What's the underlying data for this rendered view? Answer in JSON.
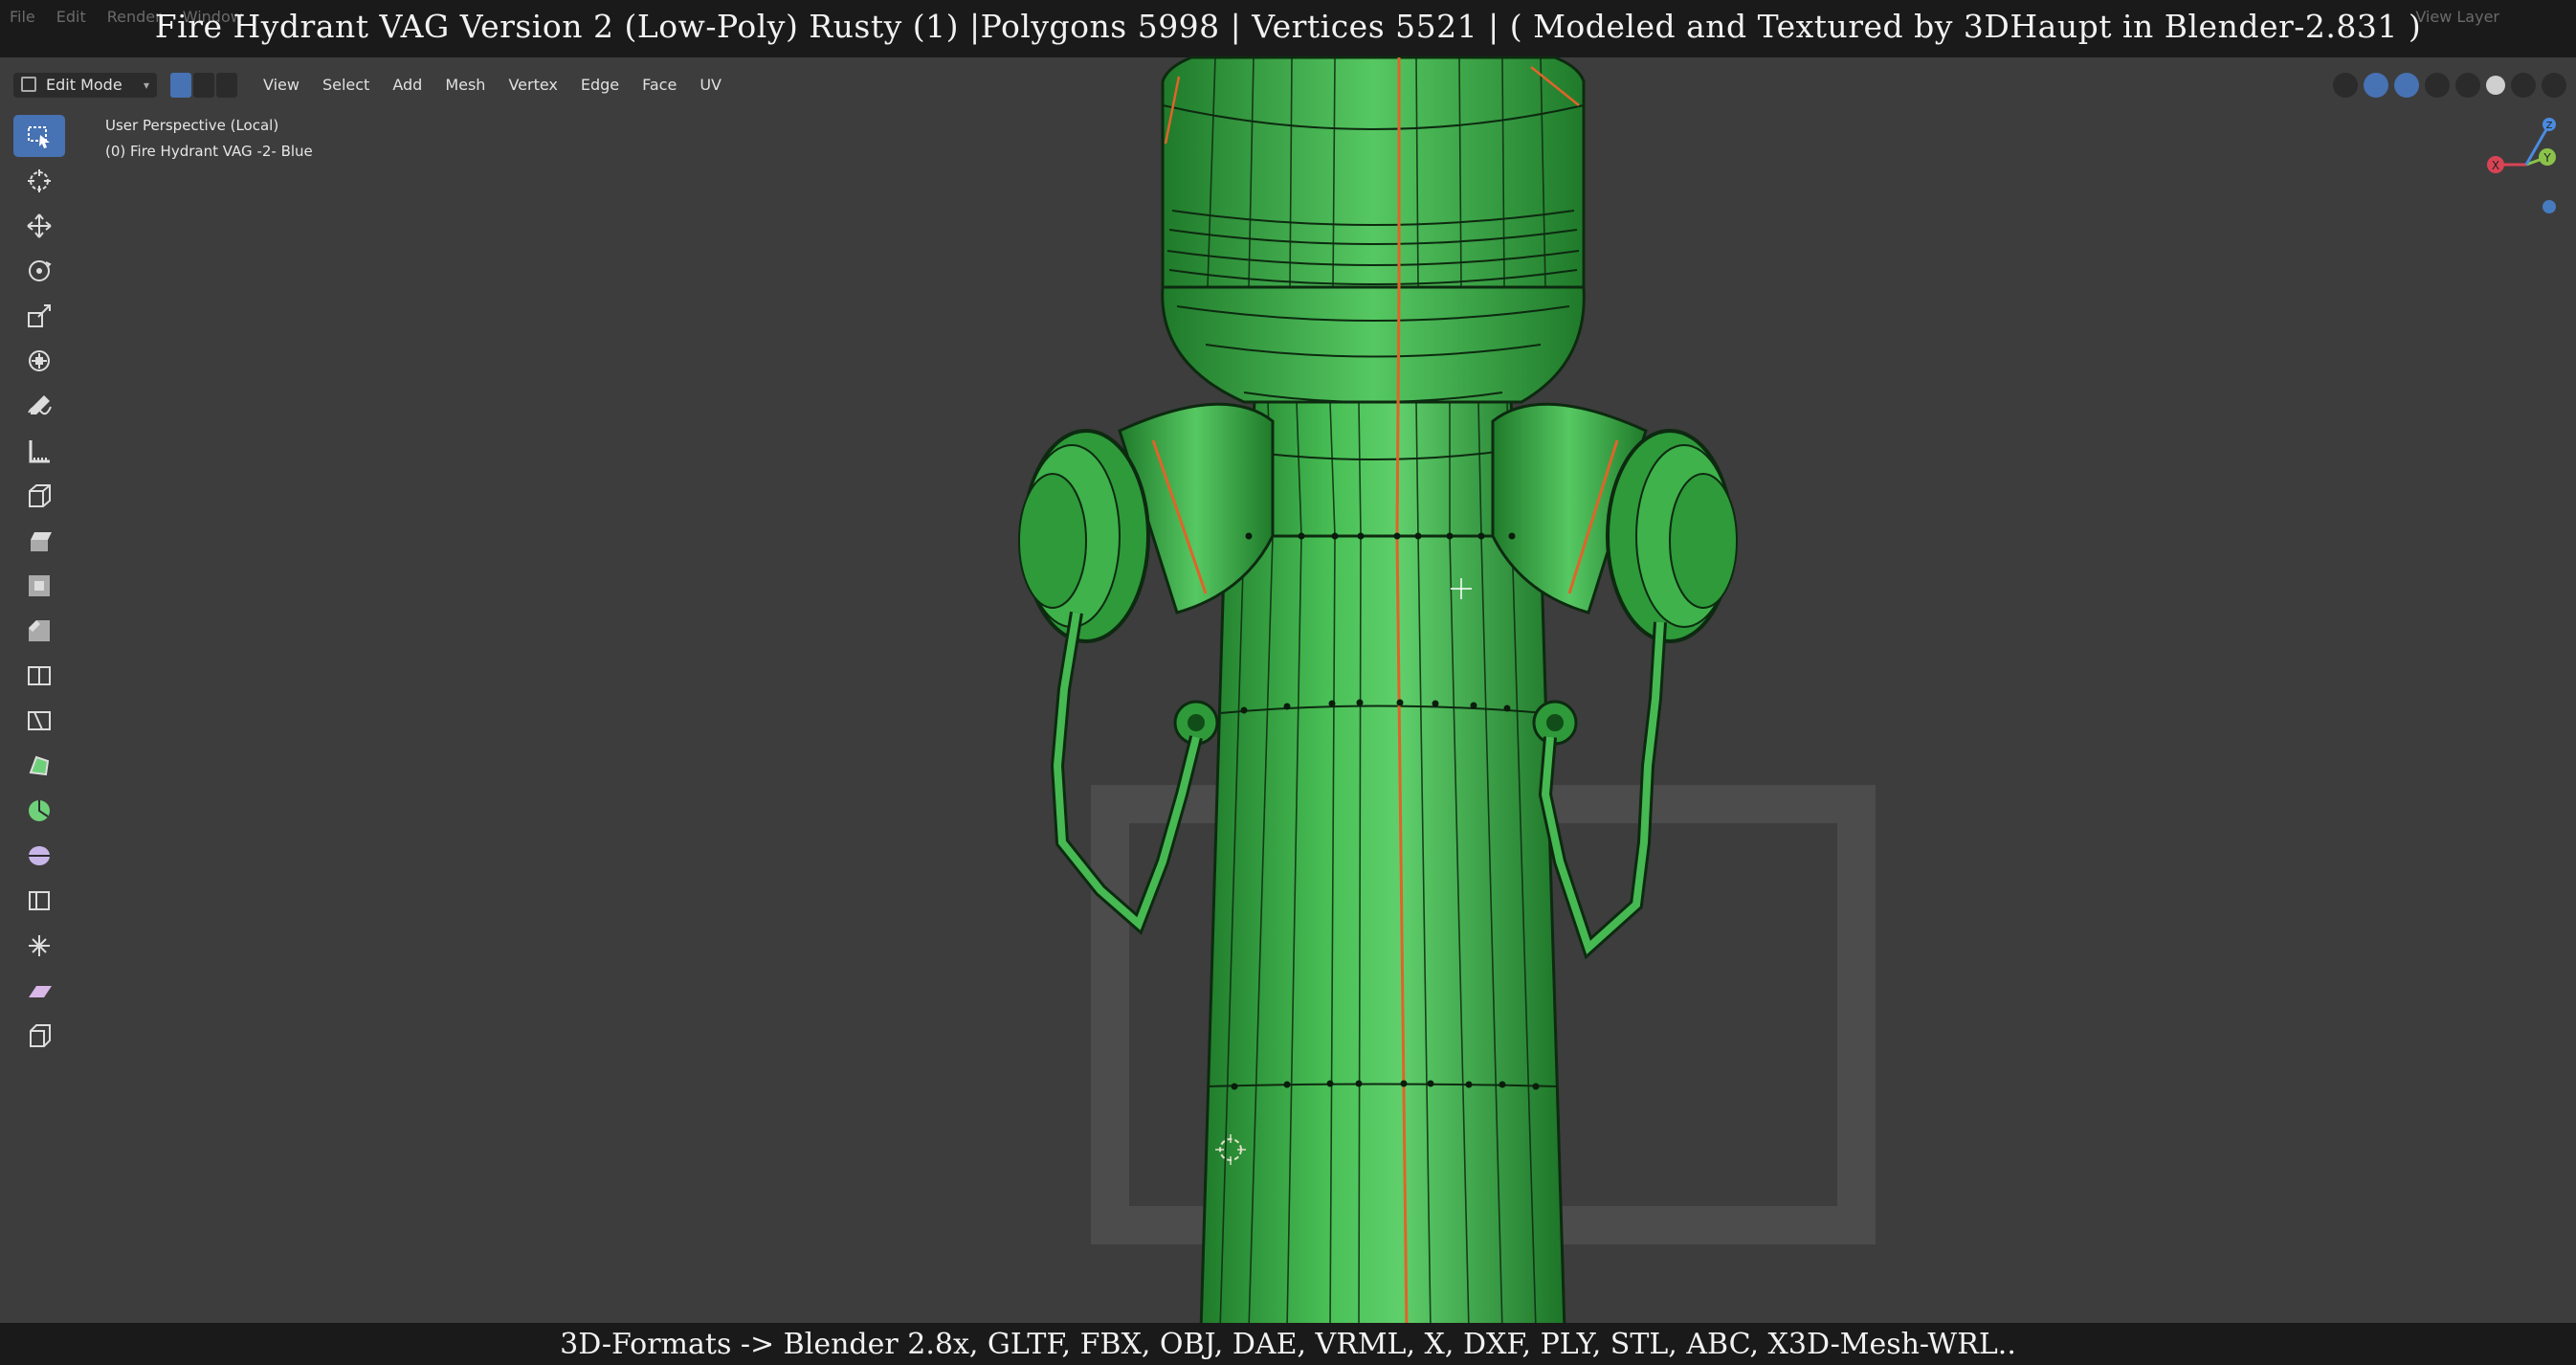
{
  "title_overlay": "Fire Hydrant VAG Version 2 (Low-Poly) Rusty (1) |Polygons 5998  | Vertices 5521 | ( Modeled and Textured by 3DHaupt in Blender-2.831 )",
  "ghost_menu": [
    "File",
    "Edit",
    "Render",
    "Window"
  ],
  "ghost_right": "View Layer",
  "header": {
    "mode": "Edit Mode",
    "menus": [
      "View",
      "Select",
      "Add",
      "Mesh",
      "Vertex",
      "Edge",
      "Face",
      "UV"
    ]
  },
  "viewport": {
    "perspective": "User Perspective (Local)",
    "object": "(0) Fire Hydrant VAG -2- Blue"
  },
  "toolbar": {
    "tools": [
      {
        "icon": "select-box-icon",
        "active": true
      },
      {
        "icon": "cursor-icon"
      },
      {
        "icon": "move-icon"
      },
      {
        "icon": "rotate-icon"
      },
      {
        "icon": "scale-icon"
      },
      {
        "icon": "transform-icon"
      },
      {
        "icon": "annotate-icon"
      },
      {
        "icon": "measure-icon"
      },
      {
        "icon": "add-cube-icon"
      },
      {
        "icon": "extrude-icon"
      },
      {
        "icon": "inset-icon"
      },
      {
        "icon": "bevel-icon"
      },
      {
        "icon": "loop-cut-icon"
      },
      {
        "icon": "knife-icon"
      },
      {
        "icon": "poly-build-icon"
      },
      {
        "icon": "spin-icon"
      },
      {
        "icon": "smooth-icon"
      },
      {
        "icon": "edge-slide-icon"
      },
      {
        "icon": "shrink-fatten-icon"
      },
      {
        "icon": "shear-icon"
      },
      {
        "icon": "rip-region-icon"
      }
    ]
  },
  "gizmo": {
    "x_label": "X",
    "y_label": "Y",
    "z_label": "Z"
  },
  "footer": "3D-Formats -> Blender 2.8x, GLTF, FBX, OBJ, DAE, VRML, X, DXF, PLY, STL, ABC, X3D-Mesh-WRL..",
  "colors": {
    "mesh_green": "#33a83f",
    "seam": "#e0642a",
    "accent_blue": "#4772b3",
    "background": "#3d3d3d"
  }
}
